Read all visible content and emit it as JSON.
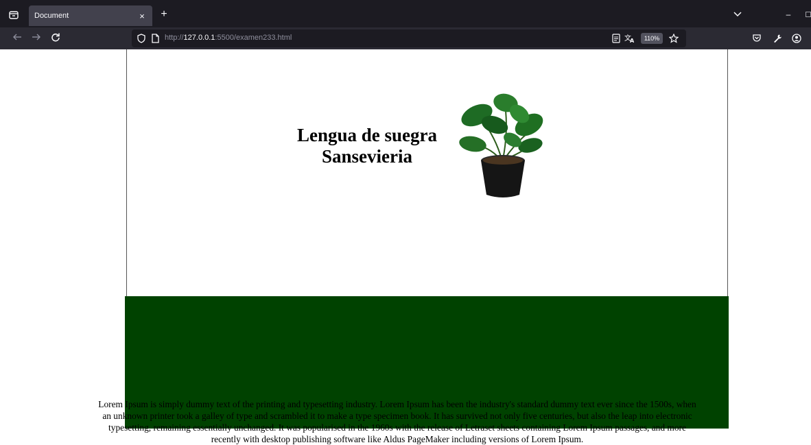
{
  "browser": {
    "tab_title": "Document",
    "tab_close": "×",
    "new_tab": "+",
    "minimize": "–",
    "url_scheme": "http://",
    "url_host": "127.0.0.1",
    "url_rest": ":5500/examen233.html",
    "zoom": "110%"
  },
  "page": {
    "title_line1": "Lengua de suegra",
    "title_line2": "Sansevieria",
    "lorem": "Lorem Ipsum is simply dummy text of the printing and typesetting industry. Lorem Ipsum has been the industry's standard dummy text ever since the 1500s, when an unknown printer took a galley of type and scrambled it to make a type specimen book. It has survived not only five centuries, but also the leap into electronic typesetting, remaining essentially unchanged. It was popularised in the 1960s with the release of Letraset sheets containing Lorem Ipsum passages, and more recently with desktop publishing software like Aldus PageMaker including versions of Lorem Ipsum.",
    "plant_image": "potted-monstera-plant",
    "green_color": "#004200"
  },
  "icons": {
    "back": "arrow-left-icon",
    "forward": "arrow-right-icon",
    "reload": "reload-icon",
    "shield": "shield-icon",
    "page": "page-icon",
    "reader": "reader-view-icon",
    "translate": "translate-icon",
    "bookmark": "star-icon",
    "pocket": "pocket-icon",
    "tools": "wrench-icon",
    "account": "account-icon"
  }
}
